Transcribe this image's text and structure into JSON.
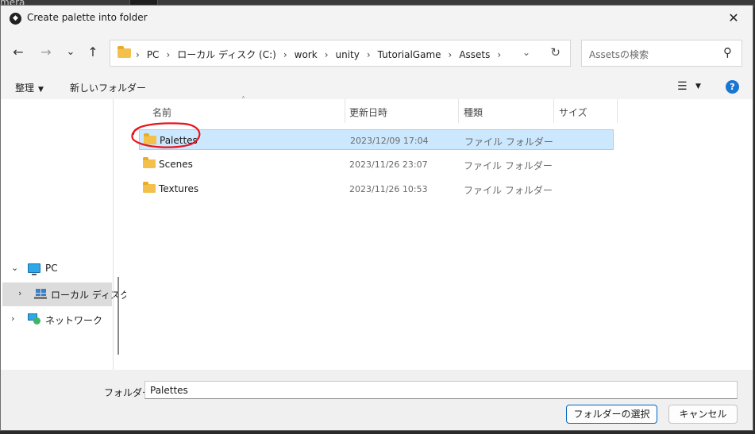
{
  "background": {
    "partial_text": "mera"
  },
  "window": {
    "title": "Create palette into folder",
    "close_glyph": "✕"
  },
  "nav": {
    "back": "←",
    "forward": "→",
    "recent": "⌄",
    "up": "↑"
  },
  "address": {
    "crumbs": [
      "PC",
      "ローカル ディスク (C:)",
      "work",
      "unity",
      "TutorialGame",
      "Assets"
    ],
    "separator": "›",
    "dropdown_glyph": "⌄",
    "refresh_glyph": "↻"
  },
  "search": {
    "placeholder": "Assetsの検索",
    "icon_glyph": "⚲"
  },
  "toolbar": {
    "organize": "整理",
    "new_folder": "新しいフォルダー",
    "view_glyph": "☰",
    "caret": "▼",
    "help": "?"
  },
  "sidebar": {
    "items": [
      {
        "label": "PC",
        "chevron": "⌄"
      },
      {
        "label": "ローカル ディスク",
        "chevron": "›"
      },
      {
        "label": "ネットワーク",
        "chevron": "›"
      }
    ]
  },
  "columns": {
    "name": "名前",
    "date": "更新日時",
    "type": "種類",
    "size": "サイズ",
    "sort_glyph": "˄"
  },
  "files": [
    {
      "name": "Palettes",
      "date": "2023/12/09 17:04",
      "type": "ファイル フォルダー"
    },
    {
      "name": "Scenes",
      "date": "2023/11/26 23:07",
      "type": "ファイル フォルダー"
    },
    {
      "name": "Textures",
      "date": "2023/11/26 10:53",
      "type": "ファイル フォルダー"
    }
  ],
  "footer": {
    "folder_label": "フォルダー:",
    "folder_value": "Palettes",
    "select_button": "フォルダーの選択",
    "cancel_button": "キャンセル"
  },
  "colors": {
    "accent": "#0067c0",
    "selection": "#cce8ff",
    "annotation": "#e8141c",
    "folder": "#f3c14b"
  }
}
